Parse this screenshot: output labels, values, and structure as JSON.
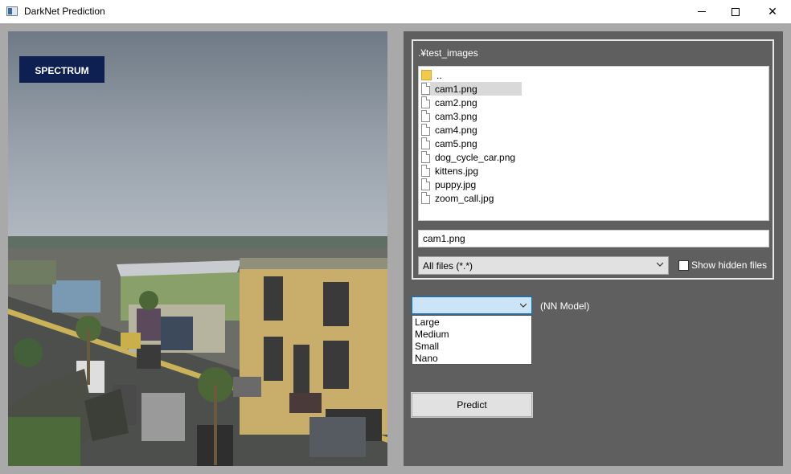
{
  "window": {
    "title": "DarkNet Prediction",
    "minimize_glyph": "–",
    "close_glyph": "✕"
  },
  "image": {
    "overlay_text": "SPECTRUM"
  },
  "file_browser": {
    "path": ".¥test_images",
    "items": [
      {
        "label": "..",
        "type": "folder"
      },
      {
        "label": "cam1.png",
        "type": "file"
      },
      {
        "label": "cam2.png",
        "type": "file"
      },
      {
        "label": "cam3.png",
        "type": "file"
      },
      {
        "label": "cam4.png",
        "type": "file"
      },
      {
        "label": "cam5.png",
        "type": "file"
      },
      {
        "label": "dog_cycle_car.png",
        "type": "file"
      },
      {
        "label": "kittens.jpg",
        "type": "file"
      },
      {
        "label": "puppy.jpg",
        "type": "file"
      },
      {
        "label": "zoom_call.jpg",
        "type": "file"
      }
    ],
    "selected": "cam1.png",
    "filename_value": "cam1.png",
    "filter_value": "All files (*.*)",
    "show_hidden_label": "Show hidden files",
    "show_hidden_checked": false
  },
  "model": {
    "selected_value": "",
    "label": "(NN Model)",
    "options": [
      "Large",
      "Medium",
      "Small",
      "Nano"
    ]
  },
  "predict": {
    "label": "Predict"
  }
}
